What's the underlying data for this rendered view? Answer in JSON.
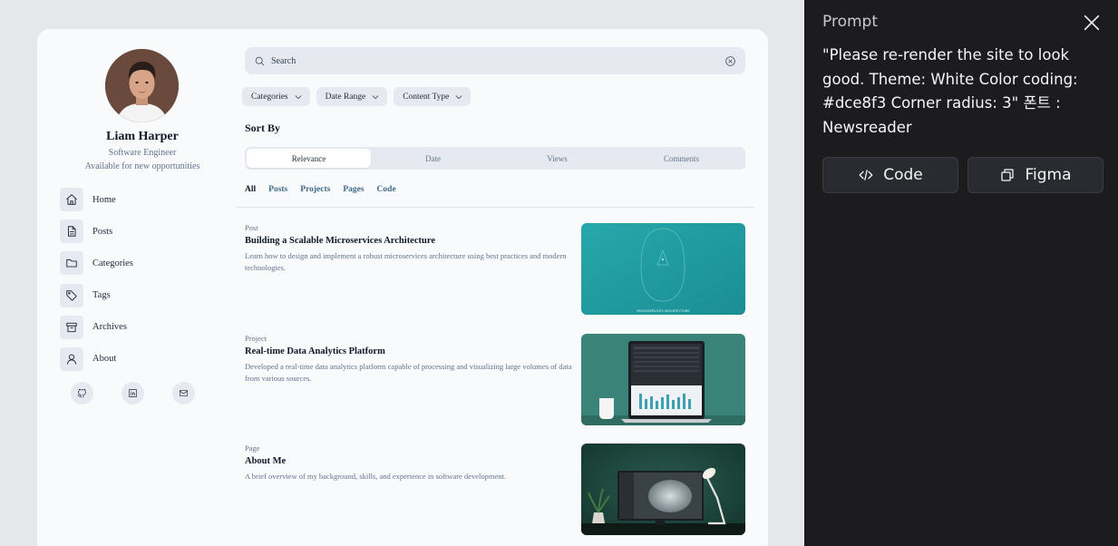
{
  "profile": {
    "name": "Liam Harper",
    "role": "Software Engineer",
    "status": "Available for new opportunities"
  },
  "nav": [
    {
      "label": "Home",
      "icon": "home-icon"
    },
    {
      "label": "Posts",
      "icon": "document-icon"
    },
    {
      "label": "Categories",
      "icon": "folder-icon"
    },
    {
      "label": "Tags",
      "icon": "tag-icon"
    },
    {
      "label": "Archives",
      "icon": "archive-icon"
    },
    {
      "label": "About",
      "icon": "user-icon"
    }
  ],
  "socials": [
    "github-icon",
    "linkedin-icon",
    "mail-icon"
  ],
  "search": {
    "placeholder": "Search"
  },
  "filters": [
    "Categories",
    "Date Range",
    "Content Type"
  ],
  "sort": {
    "label": "Sort By",
    "options": [
      "Relevance",
      "Date",
      "Views",
      "Comments"
    ],
    "selected": "Relevance"
  },
  "tabs": [
    "All",
    "Posts",
    "Projects",
    "Pages",
    "Code"
  ],
  "active_tab": "All",
  "results": [
    {
      "type": "Post",
      "title": "Building a Scalable Microservices Architecture",
      "description": "Learn how to design and implement a robust microservices architecture using best practices and modern technologies.",
      "thumb_caption": "MICROSERVICES ARCHITECTURE"
    },
    {
      "type": "Project",
      "title": "Real-time Data Analytics Platform",
      "description": "Developed a real-time data analytics platform capable of processing and visualizing large volumes of data from various sources."
    },
    {
      "type": "Page",
      "title": "About Me",
      "description": "A brief overview of my background, skills, and experience in software development."
    }
  ],
  "panel": {
    "title": "Prompt",
    "prompt": "\"Please re-render the site to look good. Theme: White Color coding: #dce8f3 Corner radius: 3\" 폰트 : Newsreader",
    "code_label": "Code",
    "figma_label": "Figma"
  },
  "colors": {
    "page_bg": "#f8fafc",
    "chip_bg": "#e6eaf0",
    "panel_bg": "#1c1c1f",
    "accent_link": "#3f6b8a"
  }
}
